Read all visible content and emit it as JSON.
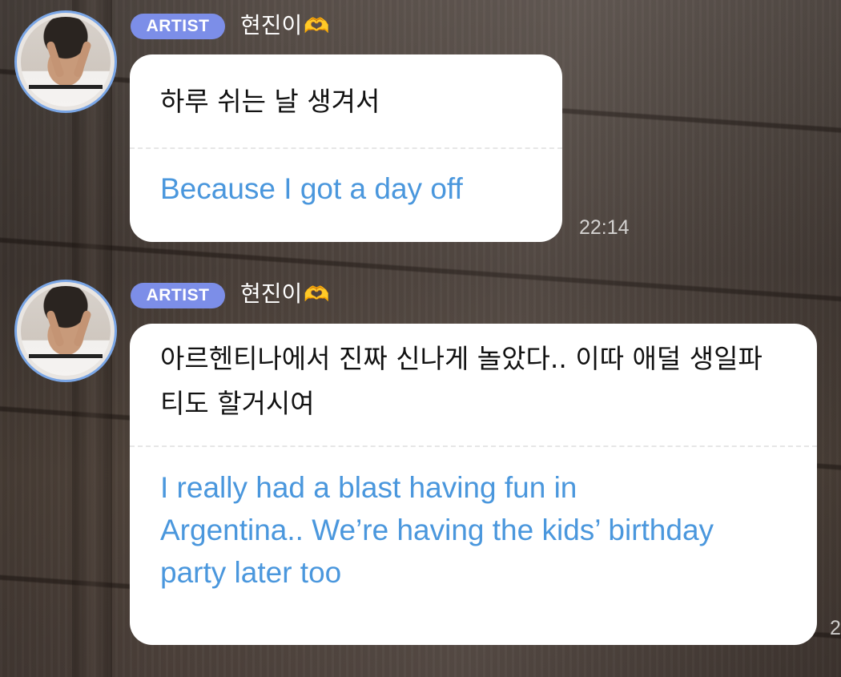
{
  "messages": [
    {
      "badge": "ARTIST",
      "sender": "현진이",
      "heart_icon": "heart-hands-emoji",
      "original_text": "하루 쉬는 날 생겨서",
      "translation": "Because I got a day off",
      "time": "22:14"
    },
    {
      "badge": "ARTIST",
      "sender": "현진이",
      "heart_icon": "heart-hands-emoji",
      "original_text": "아르헨티나에서 진짜 신나게 놀았다.. 이따 애덜 생일파티도 할거시여",
      "translation": "I really had a blast having fun in Argentina.. We’re having the kids’ birthday party later too",
      "time": "2"
    }
  ],
  "colors": {
    "badge": "#7c8ee8",
    "translation": "#4a97dd",
    "avatar_ring": "#7aa6e6",
    "heart": "#f4bf2d"
  }
}
